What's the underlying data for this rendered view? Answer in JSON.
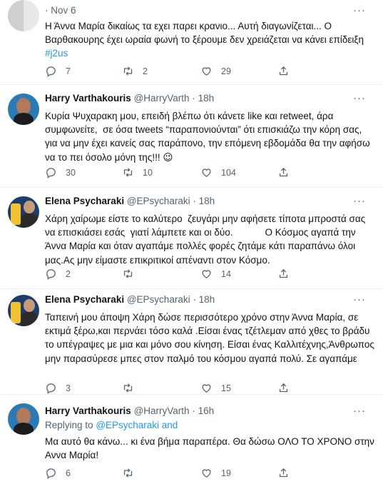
{
  "tweets": [
    {
      "name": "",
      "handle": "",
      "time": "Nov 6",
      "replying_label": "",
      "replying_handles": "",
      "text": "Η Άννα Μαρία δικαίως τα εχει παρει κρανιο... Αυτή διαγωνίζεται... Ο Βαρθακουρης έχει ωραία φωνή το ξέρουμε δεν χρειάζεται να κάνει επίδειξη",
      "hashtag": "#j2us",
      "replies": "7",
      "retweets": "2",
      "likes": "29"
    },
    {
      "name": "Harry Varthakouris",
      "handle": "@HarryVarth",
      "time": "18h",
      "text": "Κυρία Ψυχαρακη μου, επειδή βλέπω ότι κάνετε like και retweet, άρα συμφωνείτε,  σε όσα tweets “παραπονιούνται” ότι επισκιάζω την κόρη σας, για να μην έχει κανείς σας παράπονο, την επόμενη εβδομάδα θα την αφήσω να το πει όσολο μόνη της!!! 😉",
      "replies": "30",
      "retweets": "10",
      "likes": "104"
    },
    {
      "name": "Elena Psycharaki",
      "handle": "@EPsycharaki",
      "time": "18h",
      "text": "Χάρη χαίρωμε είστε το καλύτερο  ζευγάρι μην αφήσετε τίποτα μπροστά σας να επισκιάσει εσάς  γιατί λάμπετε και οι δύο.            Ο Κόσμος αγαπά την Άννα Μαρία και όταν αγαπάμε πολλές φορές ζητάμε κάτι παραπάνω όλοι μας.Ας μην είμαστε επικριτικοί απέναντι στον Κόσμο.",
      "replies": "2",
      "retweets": "",
      "likes": "14"
    },
    {
      "name": "Elena Psycharaki",
      "handle": "@EPsycharaki",
      "time": "18h",
      "text": "Ταπεινή μου άποψη Χάρη δώσε περισσότερο χρόνο στην Άννα Μαρία, σε εκτιμά ξέρω,και περνάει τόσο καλά .Είσαι ένας τζέτλεμαν από χθες το βράδυ το υπέγραψες με μια και μόνο σου κίνηση. Είσαι ένας Καλλιτέχνης,Άνθρωπος μην παρασύρεσε μπες στον παλμό του κόσμου αγαπά πολύ. Σε αγαπάμε",
      "replies": "3",
      "retweets": "",
      "likes": "15"
    },
    {
      "name": "Harry Varthakouris",
      "handle": "@HarryVarth",
      "time": "16h",
      "replying_label": "Replying to",
      "replying_handles": "@EPsycharaki and",
      "text": "Μα αυτό θα κάνω... κι ένα βήμα παραπέρα. Θα δώσω ΟΛΟ ΤΟ ΧΡΟΝΟ στην Αννα Μαρία!",
      "replies": "6",
      "retweets": "",
      "likes": "19"
    }
  ],
  "ui": {
    "dot": "·",
    "more": "···"
  },
  "colors": {
    "link": "#1d9bf0",
    "muted": "#536471",
    "divider": "#eff3f4"
  }
}
